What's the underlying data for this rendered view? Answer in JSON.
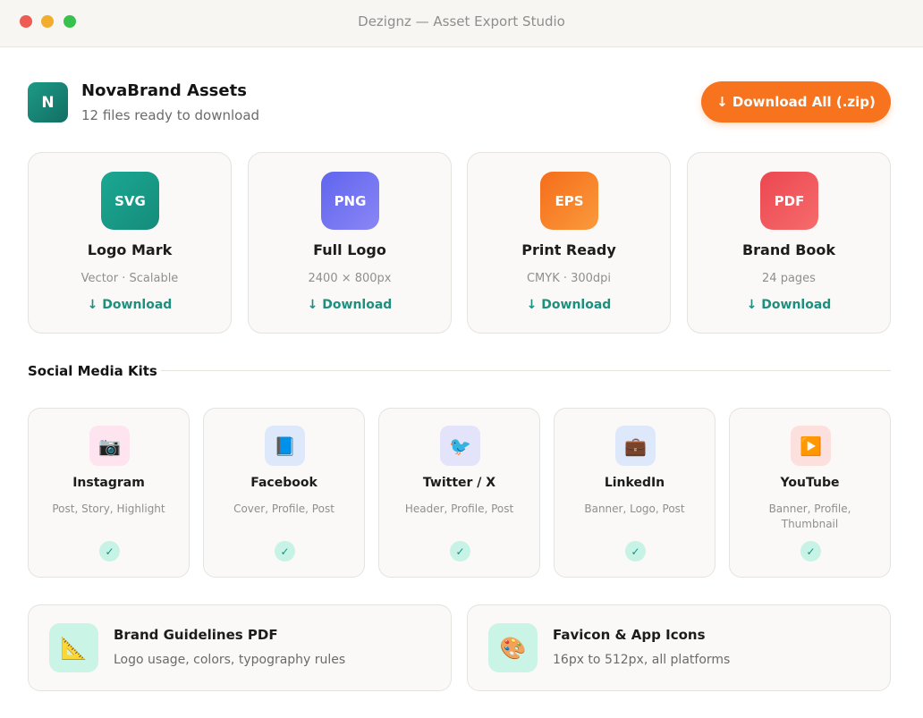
{
  "window": {
    "title": "Dezignz — Asset Export Studio"
  },
  "brand": {
    "initial": "N",
    "name": "NovaBrand Assets",
    "subtitle": "12 files ready to download"
  },
  "download_all": {
    "label": "↓ Download All (.zip)"
  },
  "files": [
    {
      "format": "SVG",
      "name": "Logo Mark",
      "meta": "Vector · Scalable",
      "action": "↓ Download",
      "color": "#1fa08c"
    },
    {
      "format": "PNG",
      "name": "Full Logo",
      "meta": "2400 × 800px",
      "action": "↓ Download",
      "color": "#6c6ff0"
    },
    {
      "format": "EPS",
      "name": "Print Ready",
      "meta": "CMYK · 300dpi",
      "action": "↓ Download",
      "color": "#f7731d"
    },
    {
      "format": "PDF",
      "name": "Brand Book",
      "meta": "24 pages",
      "action": "↓ Download",
      "color": "#ef4f55"
    }
  ],
  "social_section": {
    "title": "Social Media Kits"
  },
  "social": [
    {
      "icon": "camera-icon",
      "glyph": "📷",
      "name": "Instagram",
      "meta": "Post, Story, Highlight",
      "check": "✓",
      "bg": "#fde4ee"
    },
    {
      "icon": "book-icon",
      "glyph": "📘",
      "name": "Facebook",
      "meta": "Cover, Profile, Post",
      "check": "✓",
      "bg": "#dde9fb"
    },
    {
      "icon": "bird-icon",
      "glyph": "🐦",
      "name": "Twitter / X",
      "meta": "Header, Profile, Post",
      "check": "✓",
      "bg": "#e3e3fa"
    },
    {
      "icon": "briefcase-icon",
      "glyph": "💼",
      "name": "LinkedIn",
      "meta": "Banner, Logo, Post",
      "check": "✓",
      "bg": "#dde9fb"
    },
    {
      "icon": "play-icon",
      "glyph": "▶️",
      "name": "YouTube",
      "meta": "Banner, Profile, Thumbnail",
      "check": "✓",
      "bg": "#fbe0de"
    }
  ],
  "extras": [
    {
      "icon": "triangle-ruler-icon",
      "glyph": "📐",
      "title": "Brand Guidelines PDF",
      "subtitle": "Logo usage, colors, typography rules"
    },
    {
      "icon": "palette-icon",
      "glyph": "🎨",
      "title": "Favicon & App Icons",
      "subtitle": "16px to 512px, all platforms"
    }
  ],
  "colors": {
    "accent": "#f7731d",
    "teal": "#1e8f7e",
    "check_bg": "#c7f3e6"
  }
}
